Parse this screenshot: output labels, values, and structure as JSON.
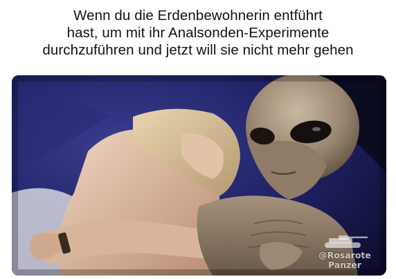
{
  "caption": {
    "lines": [
      "Wenn du die Erdenbewohnerin entführt",
      "hast, um mit ihr Analsonden-Experimente",
      "durchzuführen und jetzt will sie nicht mehr gehen"
    ]
  },
  "photo": {
    "watermark": {
      "handle": "@Rosarote",
      "name": "Panzer",
      "icon": "tank-icon"
    }
  },
  "colors": {
    "background": "#ffffff",
    "caption_text": "#111111",
    "backdrop_blue": "#1e1f5e",
    "skin": "#d9b59b",
    "alien_skin": "#a99883"
  }
}
